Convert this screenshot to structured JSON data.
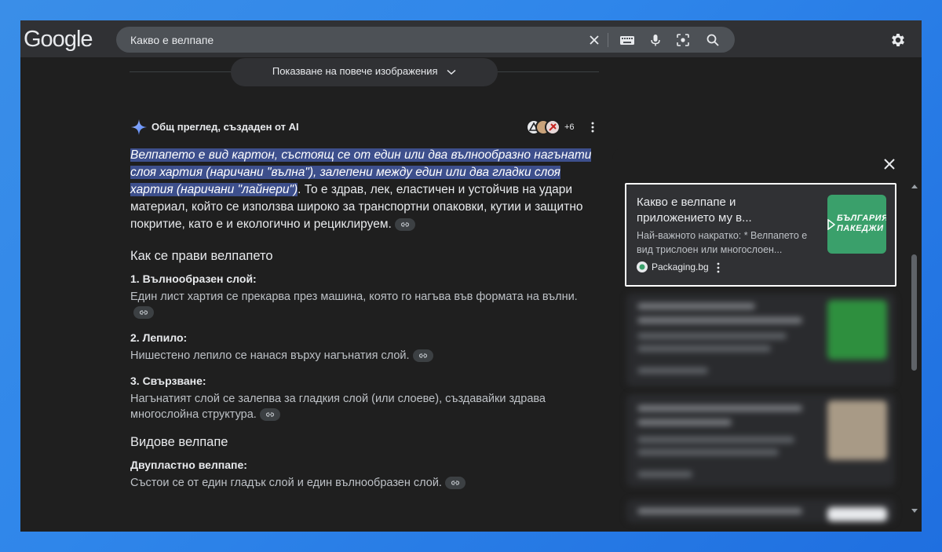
{
  "search": {
    "query": "Какво е велпапе",
    "logo": "Google"
  },
  "icons": {
    "clear": "close-icon",
    "keyboard": "keyboard-icon",
    "mic": "mic-icon",
    "lens": "lens-icon",
    "search": "search-icon",
    "settings": "gear-icon"
  },
  "images": {
    "more_label": "Показване на повече изображения"
  },
  "ai_overview": {
    "title": "Общ преглед, създаден от AI",
    "sources_more": "+6",
    "intro_highlight": "Велпапето е вид картон, състоящ се от един или два вълнообразно нагънати слоя хартия (наричани \"вълна\"), залепени между един или два гладки слоя хартия (наричани \"лайнери\")",
    "intro_rest": ". То е здрав, лек, еластичен и устойчив на удари материал, който се използва широко за транспортни опаковки, кутии и защитно покритие, като е и екологично и рециклируем.",
    "section1_title": "Как се прави велпапето",
    "steps": [
      {
        "title": "1. Вълнообразен слой:",
        "desc": "Един лист хартия се прекарва през машина, която го нагъва във формата на вълни."
      },
      {
        "title": "2. Лепило:",
        "desc": "Нишестено лепило се нанася върху нагънатия слой."
      },
      {
        "title": "3. Свързване:",
        "desc": "Нагънатият слой се залепва за гладкия слой (или слоеве), създавайки здрава многослойна структура."
      }
    ],
    "section2_title": "Видове велпапе",
    "types": [
      {
        "title": "Двупластно велпапе:",
        "desc": "Състои се от един гладък слой и един вълнообразен слой."
      }
    ]
  },
  "sources_panel": {
    "main_card": {
      "title": "Какво е велпапе и приложението му в...",
      "desc": "Най-важното накратко: * Велпапето е вид трислоен или многослоен...",
      "source": "Packaging.bg",
      "thumb_text_1": "БЪЛГАРИЯ",
      "thumb_text_2": "ПАКЕДЖИ"
    },
    "colors": {
      "thumb_green": "#3aa06b",
      "highlight": "#3d4f8c"
    }
  }
}
